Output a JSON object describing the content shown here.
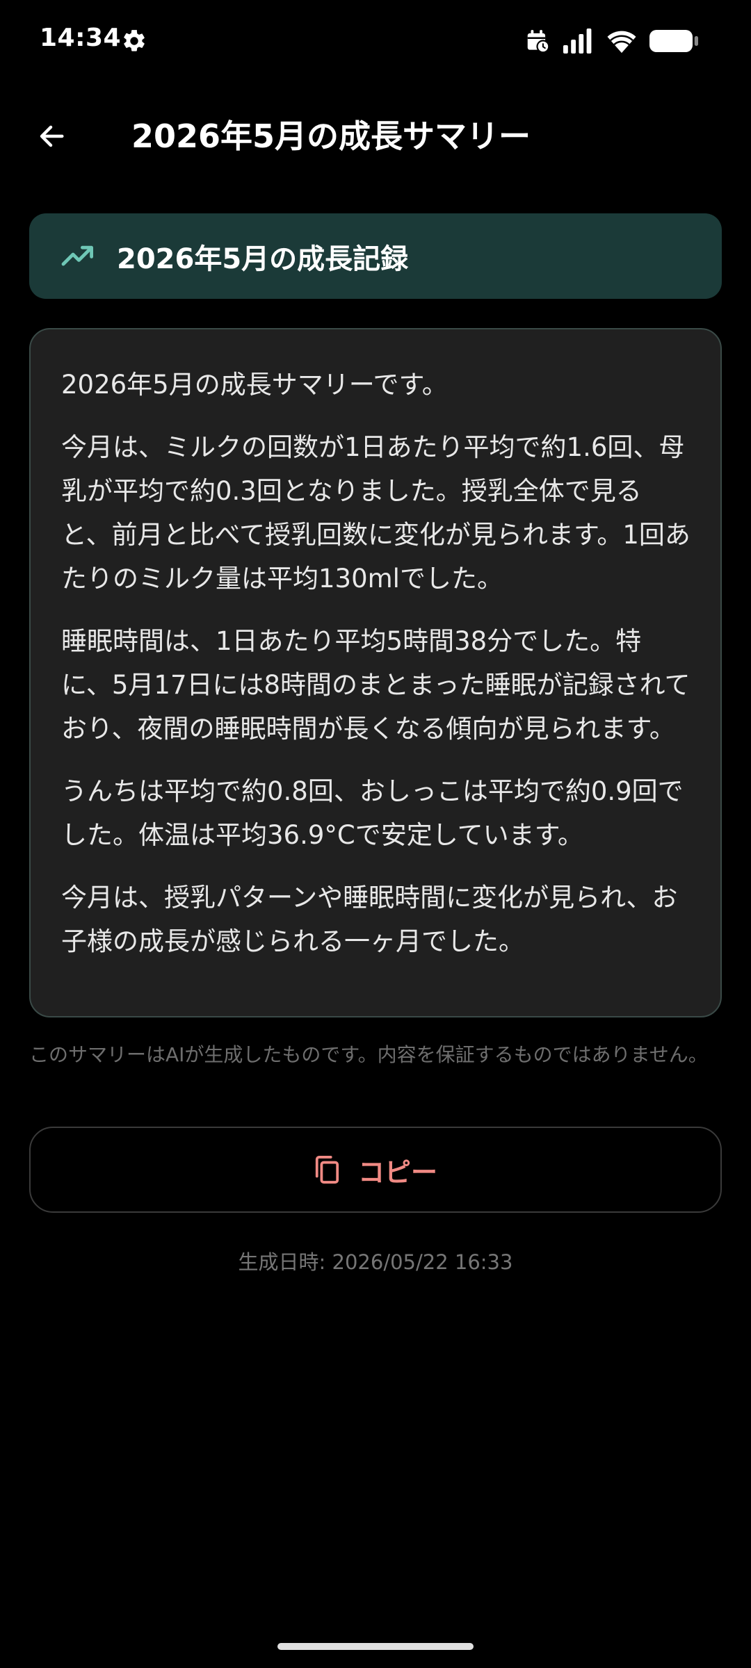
{
  "status_bar": {
    "time": "14:34",
    "icons": [
      "gear-icon",
      "calendar-clock-icon",
      "cell-signal-icon",
      "wifi-icon",
      "battery-icon"
    ]
  },
  "app_bar": {
    "title": "2026年5月の成長サマリー",
    "back_icon": "arrow-left-icon"
  },
  "header_card": {
    "icon": "trending-up-icon",
    "title": "2026年5月の成長記録"
  },
  "summary": {
    "paragraphs": [
      "2026年5月の成長サマリーです。",
      "今月は、ミルクの回数が1日あたり平均で約1.6回、母乳が平均で約0.3回となりました。授乳全体で見ると、前月と比べて授乳回数に変化が見られます。1回あたりのミルク量は平均130mlでした。",
      "睡眠時間は、1日あたり平均5時間38分でした。特に、5月17日には8時間のまとまった睡眠が記録されており、夜間の睡眠時間が長くなる傾向が見られます。",
      "うんちは平均で約0.8回、おしっこは平均で約0.9回でした。体温は平均36.9°Cで安定しています。",
      "今月は、授乳パターンや睡眠時間に変化が見られ、お子様の成長が感じられる一ヶ月でした。"
    ]
  },
  "disclaimer": "このサマリーはAIが生成したものです。内容を保証するものではありません。",
  "copy_button": {
    "label": "コピー",
    "icon": "copy-icon"
  },
  "generated": {
    "label": "生成日時:",
    "value": "2026/05/22 16:33"
  },
  "colors": {
    "background": "#000000",
    "header_card_bg": "#1b3a38",
    "accent_teal": "#6fc7b6",
    "card_bg": "#202020",
    "copy_accent": "#f08a84"
  }
}
